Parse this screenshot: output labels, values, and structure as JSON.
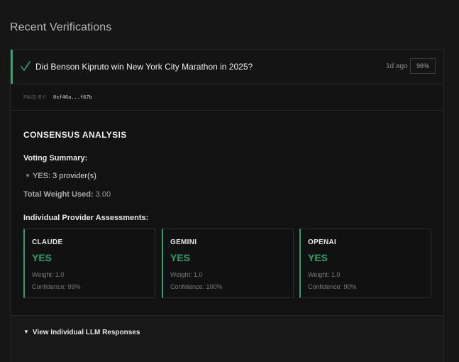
{
  "section_title": "Recent Verifications",
  "verification": {
    "question": "Did Benson Kipruto win New York City Marathon in 2025?",
    "time_ago": "1d ago",
    "confidence": "96%",
    "status_icon": "check-icon",
    "paid_by_label": "PAID BY:",
    "paid_by_address": "0xf46a...f67b"
  },
  "consensus": {
    "title": "CONSENSUS ANALYSIS",
    "voting_summary_title": "Voting Summary:",
    "vote_items": [
      "YES: 3 provider(s)"
    ],
    "total_weight_label": "Total Weight Used:",
    "total_weight_value": "3.00",
    "assessments_title": "Individual Provider Assessments:",
    "providers": [
      {
        "name": "CLAUDE",
        "verdict": "YES",
        "weight": "Weight: 1.0",
        "confidence": "Confidence: 99%"
      },
      {
        "name": "GEMINI",
        "verdict": "YES",
        "weight": "Weight: 1.0",
        "confidence": "Confidence: 100%"
      },
      {
        "name": "OPENAI",
        "verdict": "YES",
        "weight": "Weight: 1.0",
        "confidence": "Confidence: 90%"
      }
    ]
  },
  "footer": {
    "toggle_label": "View Individual LLM Responses",
    "toggle_icon": "triangle-down-icon"
  },
  "colors": {
    "accent_green": "#2ea36a",
    "verdict_green": "#26a56b",
    "background": "#161616"
  }
}
